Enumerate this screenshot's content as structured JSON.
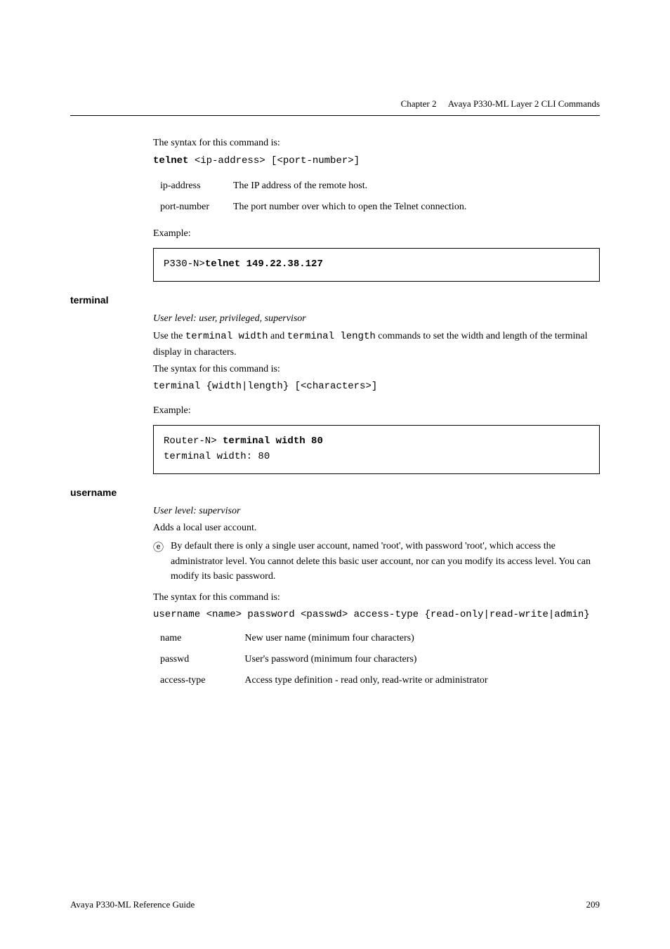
{
  "header": {
    "chapter": "Chapter 2",
    "title": "Avaya P330-ML Layer 2 CLI Commands"
  },
  "telnet": {
    "intro": "The syntax for this command is:",
    "syntax_bold": "telnet",
    "syntax_rest": " <ip-address> [<port-number>]",
    "params": [
      {
        "name": "ip-address",
        "desc": "The IP address of the remote host."
      },
      {
        "name": "port-number",
        "desc": "The port number over which to open the Telnet connection."
      }
    ],
    "example_label": "Example:",
    "code_prefix": "P330-N>",
    "code_bold": "telnet 149.22.38.127"
  },
  "terminal": {
    "section_label": "terminal",
    "userlevel": "User level: user, privileged, supervisor",
    "desc_pre": "Use the ",
    "desc_code1": "terminal width",
    "desc_mid1": " and ",
    "desc_code2": "terminal length",
    "desc_post": " commands to set the width and length of the terminal display in characters.",
    "syntax_label": "The syntax for this command is:",
    "syntax": "terminal {width|length} [<characters>]",
    "example_label": "Example:",
    "code_line1_prefix": "Router-N> ",
    "code_line1_bold": "terminal width 80",
    "code_line2": "terminal width: 80"
  },
  "username": {
    "section_label": "username",
    "userlevel": "User level: supervisor",
    "desc": "Adds a local user account.",
    "note": "By default there is only a single user account, named 'root', with password 'root', which access the administrator level. You cannot delete this basic user account, nor can you modify its access level. You can modify its basic password.",
    "syntax_label": "The syntax for this command is:",
    "syntax": "username <name> password <passwd> access-type {read-only|read-write|admin}",
    "params": [
      {
        "name": "name",
        "desc": "New user name (minimum four characters)"
      },
      {
        "name": "passwd",
        "desc": "User's password (minimum four characters)"
      },
      {
        "name": "access-type",
        "desc": "Access type definition - read only, read-write or administrator"
      }
    ]
  },
  "footer": {
    "left": "Avaya P330-ML Reference Guide",
    "right": "209"
  }
}
